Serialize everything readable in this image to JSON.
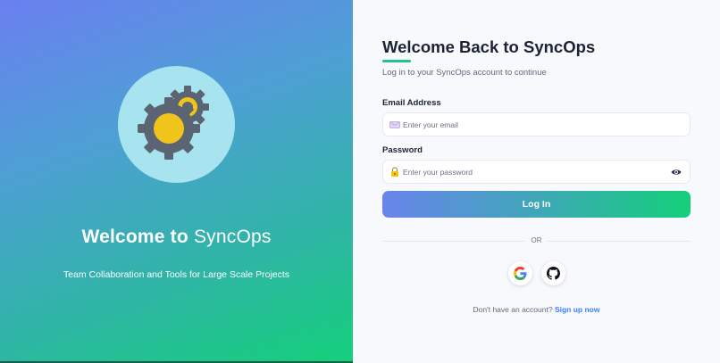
{
  "hero": {
    "title_prefix": "Welcome to",
    "title_brand": "SyncOps",
    "subtitle": "Team Collaboration and Tools for Large Scale Projects",
    "icon": "gears-icon"
  },
  "form": {
    "title": "Welcome Back to SyncOps",
    "subtitle": "Log in to your SyncOps account to continue",
    "email": {
      "label": "Email Address",
      "placeholder": "Enter your email",
      "value": "",
      "icon": "envelope-icon"
    },
    "password": {
      "label": "Password",
      "placeholder": "Enter your password",
      "value": "",
      "icon": "lock-icon",
      "toggle_icon": "eye-icon"
    },
    "login_label": "Log In",
    "divider_text": "OR",
    "social": [
      {
        "name": "google",
        "icon": "google-icon"
      },
      {
        "name": "github",
        "icon": "github-icon"
      }
    ],
    "signup_prompt": "Don't have an account?",
    "signup_link": "Sign up now"
  },
  "colors": {
    "accent_gradient_start": "#6a84ec",
    "accent_gradient_end": "#14d07a",
    "link": "#3b82f6",
    "title_text": "#1b2236"
  }
}
